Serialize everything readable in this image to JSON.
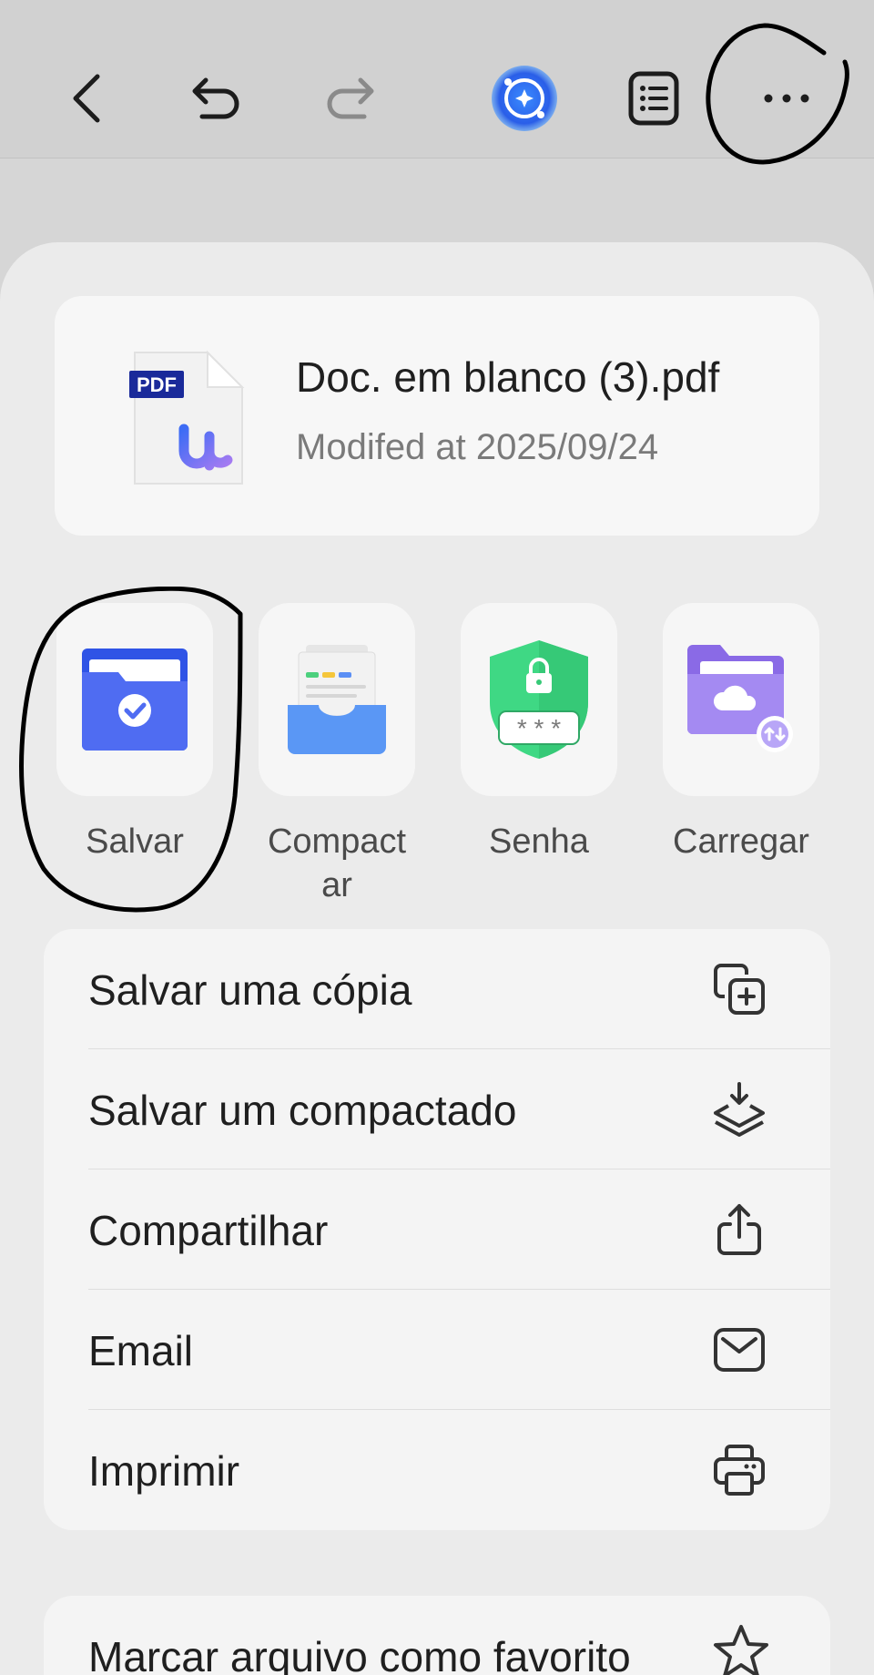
{
  "toolbar": {
    "back_icon": "chevron-left-icon",
    "undo_icon": "undo-icon",
    "redo_icon": "redo-icon",
    "ai_icon": "ai-assistant-icon",
    "outline_icon": "list-icon",
    "more_icon": "more-horizontal-icon"
  },
  "file": {
    "name": "Doc. em blanco (3).pdf",
    "modified": "Modifed at 2025/09/24",
    "badge": "PDF"
  },
  "actions": [
    {
      "label": "Salvar",
      "icon": "folder-check-icon"
    },
    {
      "label": "Compactar",
      "icon": "document-tray-icon"
    },
    {
      "label": "Senha",
      "icon": "shield-lock-icon"
    },
    {
      "label": "Carregar",
      "icon": "cloud-folder-icon"
    }
  ],
  "menu": [
    {
      "label": "Salvar uma cópia",
      "icon": "copy-plus-icon"
    },
    {
      "label": "Salvar um compactado",
      "icon": "layers-download-icon"
    },
    {
      "label": "Compartilhar",
      "icon": "share-icon"
    },
    {
      "label": "Email",
      "icon": "mail-icon"
    },
    {
      "label": "Imprimir",
      "icon": "printer-icon"
    }
  ],
  "menu2": [
    {
      "label": "Marcar arquivo como favorito",
      "icon": "star-icon"
    }
  ],
  "colors": {
    "accent_blue": "#3d5cf0",
    "shield_green": "#3fd884",
    "folder_purple": "#9b7cf0"
  }
}
